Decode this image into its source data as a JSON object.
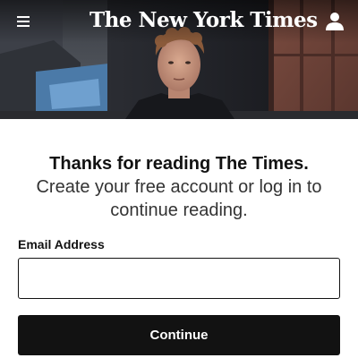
{
  "header": {
    "masthead": "The New York Times",
    "menu_icon": "hamburger-menu-icon",
    "account_icon": "user-account-icon",
    "text_color": "#ffffff"
  },
  "hero": {
    "image": "portrait-photo"
  },
  "main": {
    "headline": "Thanks for reading The Times.",
    "subhead": "Create your free account or log in to continue reading.",
    "email": {
      "label": "Email Address",
      "value": "",
      "placeholder": ""
    },
    "continue_label": "Continue"
  },
  "colors": {
    "primary_button": "#121212",
    "text": "#121212",
    "background": "#ffffff"
  }
}
